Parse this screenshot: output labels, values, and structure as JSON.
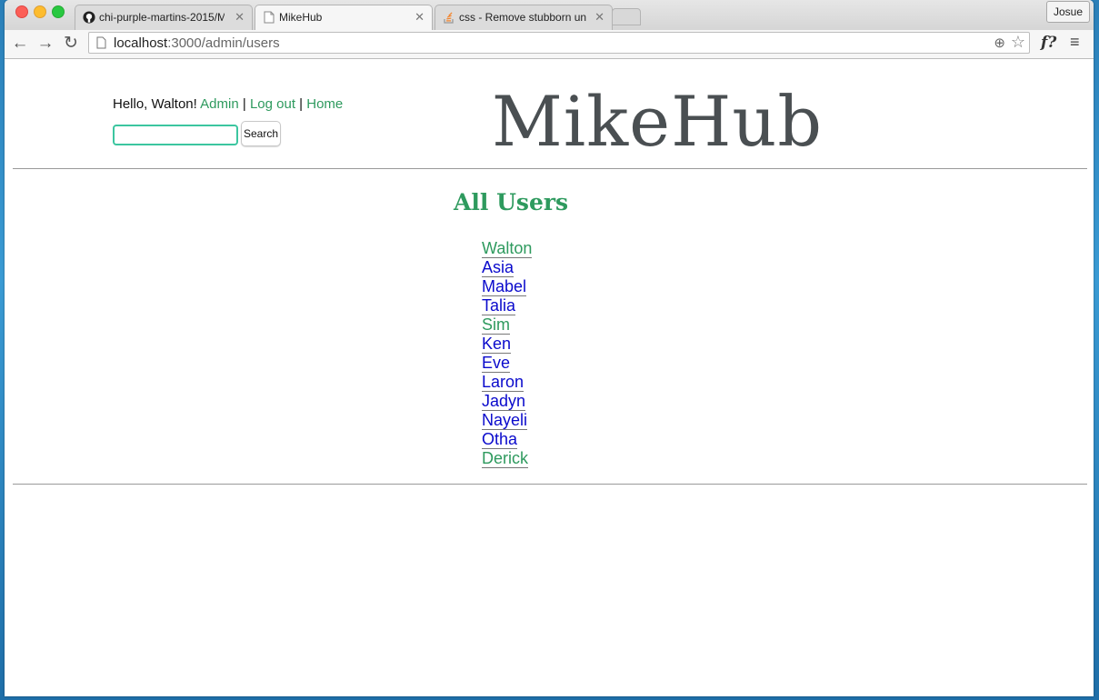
{
  "browser": {
    "tabs": [
      {
        "title": "chi-purple-martins-2015/M",
        "icon": "github-icon",
        "active": false
      },
      {
        "title": "MikeHub",
        "icon": "page-icon",
        "active": true
      },
      {
        "title": "css - Remove stubborn un",
        "icon": "stackoverflow-icon",
        "active": false
      }
    ],
    "profile_name": "Josue",
    "url_host": "localhost",
    "url_path": ":3000/admin/users",
    "extension_label": "f?"
  },
  "header": {
    "greeting": "Hello, Walton!",
    "links": {
      "admin": "Admin",
      "logout": "Log out",
      "home": "Home"
    },
    "separator": "|",
    "search_value": "",
    "search_button": "Search",
    "logo": "MikeHub"
  },
  "main": {
    "title": "All Users",
    "users": [
      {
        "name": "Walton",
        "admin": true
      },
      {
        "name": "Asia",
        "admin": false
      },
      {
        "name": "Mabel",
        "admin": false
      },
      {
        "name": "Talia",
        "admin": false
      },
      {
        "name": "Sim",
        "admin": true
      },
      {
        "name": "Ken",
        "admin": false
      },
      {
        "name": "Eve",
        "admin": false
      },
      {
        "name": "Laron",
        "admin": false
      },
      {
        "name": "Jadyn",
        "admin": false
      },
      {
        "name": "Nayeli",
        "admin": false
      },
      {
        "name": "Otha",
        "admin": false
      },
      {
        "name": "Derick",
        "admin": true
      }
    ]
  },
  "colors": {
    "accent_green": "#2e9a5e",
    "link_blue": "#0a0acc",
    "logo_gray": "#4a4f52",
    "input_border": "#3cc6a0"
  }
}
